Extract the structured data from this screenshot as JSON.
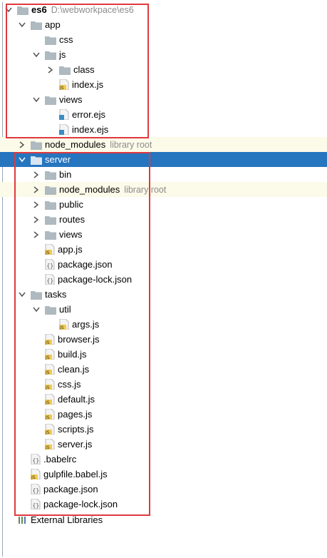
{
  "tree": {
    "root": {
      "label": "es6",
      "path": "D:\\webworkpace\\es6"
    },
    "rows": [
      {
        "label": "app",
        "type": "folder",
        "depth": 1,
        "arrow": "down"
      },
      {
        "label": "css",
        "type": "folder",
        "depth": 2,
        "arrow": "none"
      },
      {
        "label": "js",
        "type": "folder",
        "depth": 2,
        "arrow": "down"
      },
      {
        "label": "class",
        "type": "folder",
        "depth": 3,
        "arrow": "right"
      },
      {
        "label": "index.js",
        "type": "js",
        "depth": 3,
        "arrow": "none"
      },
      {
        "label": "views",
        "type": "folder",
        "depth": 2,
        "arrow": "down"
      },
      {
        "label": "error.ejs",
        "type": "ejs",
        "depth": 3,
        "arrow": "none"
      },
      {
        "label": "index.ejs",
        "type": "ejs",
        "depth": 3,
        "arrow": "none"
      },
      {
        "label": "node_modules",
        "type": "folder",
        "depth": 1,
        "arrow": "right",
        "note": "library root",
        "lib": true
      },
      {
        "label": "server",
        "type": "folder",
        "depth": 1,
        "arrow": "down",
        "selected": true
      },
      {
        "label": "bin",
        "type": "folder",
        "depth": 2,
        "arrow": "right"
      },
      {
        "label": "node_modules",
        "type": "folder",
        "depth": 2,
        "arrow": "right",
        "note": "library root",
        "lib": true
      },
      {
        "label": "public",
        "type": "folder",
        "depth": 2,
        "arrow": "right"
      },
      {
        "label": "routes",
        "type": "folder",
        "depth": 2,
        "arrow": "right"
      },
      {
        "label": "views",
        "type": "folder",
        "depth": 2,
        "arrow": "right"
      },
      {
        "label": "app.js",
        "type": "js",
        "depth": 2,
        "arrow": "none"
      },
      {
        "label": "package.json",
        "type": "json",
        "depth": 2,
        "arrow": "none"
      },
      {
        "label": "package-lock.json",
        "type": "json",
        "depth": 2,
        "arrow": "none"
      },
      {
        "label": "tasks",
        "type": "folder",
        "depth": 1,
        "arrow": "down"
      },
      {
        "label": "util",
        "type": "folder",
        "depth": 2,
        "arrow": "down"
      },
      {
        "label": "args.js",
        "type": "js",
        "depth": 3,
        "arrow": "none"
      },
      {
        "label": "browser.js",
        "type": "js",
        "depth": 2,
        "arrow": "none"
      },
      {
        "label": "build.js",
        "type": "js",
        "depth": 2,
        "arrow": "none"
      },
      {
        "label": "clean.js",
        "type": "js",
        "depth": 2,
        "arrow": "none"
      },
      {
        "label": "css.js",
        "type": "js",
        "depth": 2,
        "arrow": "none"
      },
      {
        "label": "default.js",
        "type": "js",
        "depth": 2,
        "arrow": "none"
      },
      {
        "label": "pages.js",
        "type": "js",
        "depth": 2,
        "arrow": "none"
      },
      {
        "label": "scripts.js",
        "type": "js",
        "depth": 2,
        "arrow": "none"
      },
      {
        "label": "server.js",
        "type": "js",
        "depth": 2,
        "arrow": "none"
      },
      {
        "label": ".babelrc",
        "type": "json",
        "depth": 1,
        "arrow": "none"
      },
      {
        "label": "gulpfile.babel.js",
        "type": "js",
        "depth": 1,
        "arrow": "none"
      },
      {
        "label": "package.json",
        "type": "json",
        "depth": 1,
        "arrow": "none"
      },
      {
        "label": "package-lock.json",
        "type": "json",
        "depth": 1,
        "arrow": "none"
      }
    ],
    "external": {
      "label": "External Libraries"
    }
  },
  "colors": {
    "selection": "#2675bf",
    "library_row": "#fcfae9",
    "annotation_box": "#e0393e",
    "folder": "#aeb9c0",
    "js_badge": "#f2c94c"
  }
}
